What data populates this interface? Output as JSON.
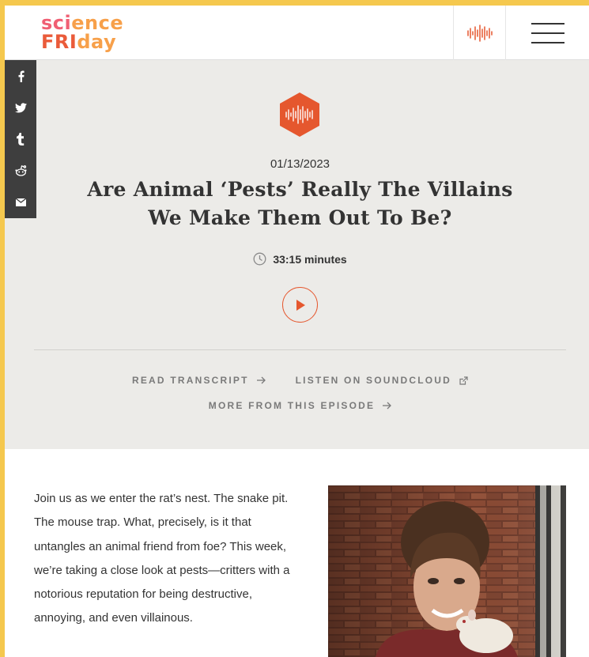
{
  "header": {
    "logo": {
      "row1": [
        "sci",
        "e",
        "nce"
      ],
      "row2": [
        "FRI",
        "day"
      ]
    },
    "audio_icon": "sound-wave-icon",
    "menu_icon": "hamburger-icon"
  },
  "share": [
    {
      "icon": "facebook-icon",
      "glyph": "f"
    },
    {
      "icon": "twitter-icon",
      "glyph": "bird"
    },
    {
      "icon": "tumblr-icon",
      "glyph": "t"
    },
    {
      "icon": "reddit-icon",
      "glyph": "alien"
    },
    {
      "icon": "email-icon",
      "glyph": "envelope"
    }
  ],
  "episode": {
    "date": "01/13/2023",
    "title": "Are Animal ‘Pests’ Really The Villains We Make Them Out To Be?",
    "duration": "33:15 minutes"
  },
  "links": {
    "read_transcript": "READ TRANSCRIPT",
    "listen_soundcloud": "LISTEN ON SOUNDCLOUD",
    "more_episode": "MORE FROM THIS EPISODE"
  },
  "body": {
    "text": "Join us as we enter the rat’s nest. The snake pit. The mouse trap. What, precisely, is it that untangles an animal friend from foe? This week, we’re taking a close look at pests—critters with a notorious reputation for being destructive, annoying, and even villainous."
  },
  "colors": {
    "frame": "#f5c84e",
    "accent": "#e5572e",
    "hero_bg": "#ecebe8",
    "share_bg": "#3e3e3e"
  }
}
